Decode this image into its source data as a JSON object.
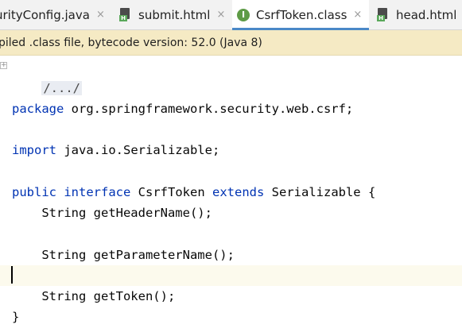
{
  "tabs": [
    {
      "label": "urityConfig.java",
      "icon": "java-file-icon",
      "active": false
    },
    {
      "label": "submit.html",
      "icon": "html-file-icon",
      "active": false
    },
    {
      "label": "CsrfToken.class",
      "icon": "class-file-icon",
      "active": true
    },
    {
      "label": "head.html",
      "icon": "html-file-icon",
      "active": false
    }
  ],
  "tab_close_glyph": "×",
  "class_icon_letter": "I",
  "html_icon_letter": "H",
  "banner": {
    "text": "piled .class file, bytecode version: 52.0 (Java 8)",
    "background": "#f5eac4"
  },
  "code": {
    "folded": "/.../",
    "package_kw": "package",
    "package_name": " org.springframework.security.web.csrf;",
    "import_kw": "import",
    "import_name": " java.io.Serializable;",
    "decl_public": "public",
    "decl_interface": "interface",
    "decl_name": " CsrfToken ",
    "decl_extends": "extends",
    "decl_super": " Serializable {",
    "m1": "    String getHeaderName();",
    "m2": "    String getParameterName();",
    "m3": "    String getToken();",
    "close": "}"
  },
  "colors": {
    "keyword": "#0033b3",
    "active_tab_underline": "#4a88c7",
    "current_line": "#fcfaed"
  }
}
